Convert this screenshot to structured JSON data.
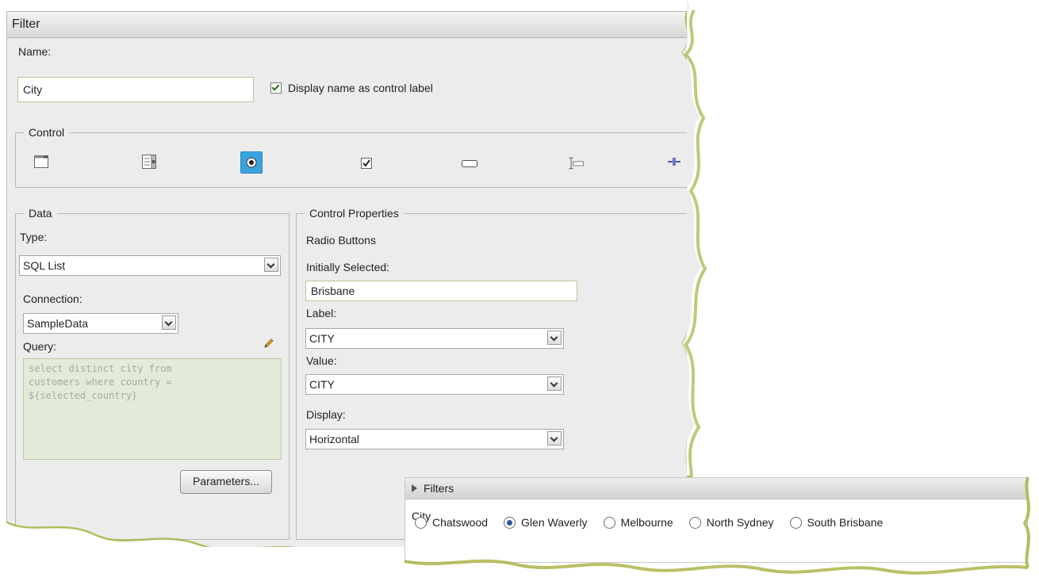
{
  "dialog": {
    "title": "Filter",
    "name_label": "Name:",
    "name_value": "City",
    "display_name_label": "Display name as control label",
    "display_name_checked": true,
    "control_legend": "Control",
    "control_icons": [
      "dropdown-icon",
      "list-icon",
      "radio-button-icon",
      "checkbox-icon",
      "textbox-icon",
      "text-cursor-icon",
      "slider-icon"
    ],
    "selected_control": "radio-button-icon",
    "data": {
      "legend": "Data",
      "type_label": "Type:",
      "type_value": "SQL List",
      "connection_label": "Connection:",
      "connection_value": "SampleData",
      "query_label": "Query:",
      "query_text": "select distinct city from\ncustomers where country =\n${selected_country}",
      "parameters_button": "Parameters..."
    },
    "control_properties": {
      "legend": "Control Properties",
      "control_type": "Radio Buttons",
      "initially_selected_label": "Initially Selected:",
      "initially_selected_value": "Brisbane",
      "label_label": "Label:",
      "label_value": "CITY",
      "value_label": "Value:",
      "value_value": "CITY",
      "display_label": "Display:",
      "display_value": "Horizontal"
    }
  },
  "filters_panel": {
    "title": "Filters",
    "field_label": "City",
    "options": [
      {
        "label": "Chatswood",
        "selected": false
      },
      {
        "label": "Glen Waverly",
        "selected": true
      },
      {
        "label": "Melbourne",
        "selected": false
      },
      {
        "label": "North Sydney",
        "selected": false
      },
      {
        "label": "South Brisbane",
        "selected": false
      }
    ]
  },
  "colors": {
    "torn_edge_shadow": "#a8b040",
    "selected_control_bg": "#3aa3dc",
    "input_border": "#b5c89a"
  }
}
